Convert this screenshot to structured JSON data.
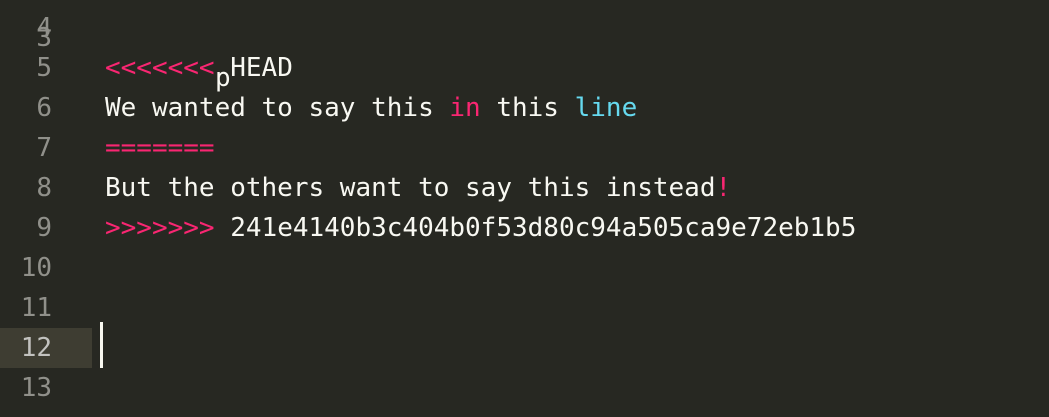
{
  "editor": {
    "colors": {
      "background": "#272822",
      "current_line": "#3e3d32",
      "gutter_text": "#90908a",
      "text": "#f8f8f2",
      "keyword_pink": "#f92672",
      "keyword_cyan": "#66d9ef"
    },
    "partial_line": {
      "number": "3",
      "text": "",
      "glyph": "p"
    },
    "lines": [
      {
        "number": "4",
        "segments": []
      },
      {
        "number": "5",
        "segments": [
          {
            "text": "<<<<<<<",
            "color": "pink"
          },
          {
            "text": " HEAD",
            "color": "text"
          }
        ]
      },
      {
        "number": "6",
        "segments": [
          {
            "text": "We wanted to say this ",
            "color": "text"
          },
          {
            "text": "in",
            "color": "pink"
          },
          {
            "text": " this ",
            "color": "text"
          },
          {
            "text": "line",
            "color": "cyan"
          }
        ]
      },
      {
        "number": "7",
        "segments": [
          {
            "text": "=======",
            "color": "pink"
          }
        ]
      },
      {
        "number": "8",
        "segments": [
          {
            "text": "But the others want to say this instead",
            "color": "text"
          },
          {
            "text": "!",
            "color": "pink"
          }
        ]
      },
      {
        "number": "9",
        "segments": [
          {
            "text": ">>>>>>>",
            "color": "pink"
          },
          {
            "text": " 241e4140b3c404b0f53d80c94a505ca9e72eb1b5",
            "color": "text"
          }
        ]
      },
      {
        "number": "10",
        "segments": []
      },
      {
        "number": "11",
        "segments": []
      },
      {
        "number": "12",
        "segments": [],
        "current": true
      },
      {
        "number": "13",
        "segments": []
      }
    ]
  }
}
